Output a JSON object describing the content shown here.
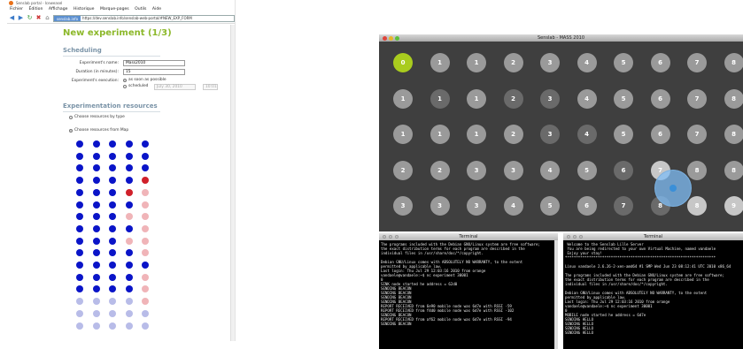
{
  "firefox": {
    "title": "Senslab portal - Iceweasel",
    "menu": [
      "Fichier",
      "Édition",
      "Affichage",
      "Historique",
      "Marque-pages",
      "Outils",
      "Aide"
    ],
    "site_badge": "senslab.info",
    "url": "https://dev.senslab.info/senslab-web-portal/#NEW_EXP_FORM"
  },
  "form": {
    "heading": "New experiment (1/3)",
    "scheduling_heading": "Scheduling",
    "name_label": "Experiment's name:",
    "name_value": "Mass2010",
    "duration_label": "Duration (in minutes):",
    "duration_value": "15",
    "execution_label": "Experiment's execution:",
    "asap_label": "as soon as possible",
    "scheduled_label": "scheduled",
    "scheduled_date": "July 30, 2010",
    "scheduled_time": "10:01",
    "resources_heading": "Experimentation resources",
    "by_type_label": "Choose resources by type",
    "from_map_label": "Choose resources from Map"
  },
  "node_map": {
    "rows": [
      [
        "b",
        "b",
        "b",
        "b",
        "b"
      ],
      [
        "b",
        "b",
        "b",
        "b",
        "b"
      ],
      [
        "b",
        "b",
        "b",
        "b",
        "b"
      ],
      [
        "b",
        "b",
        "b",
        "b",
        "r"
      ],
      [
        "b",
        "b",
        "b",
        "r",
        "pk"
      ],
      [
        "b",
        "b",
        "b",
        "b",
        "pk"
      ],
      [
        "b",
        "b",
        "b",
        "pk",
        "pk"
      ],
      [
        "b",
        "b",
        "b",
        "b",
        "pk"
      ],
      [
        "b",
        "b",
        "b",
        "pk",
        "pk"
      ],
      [
        "b",
        "b",
        "b",
        "b",
        "pk"
      ],
      [
        "b",
        "b",
        "b",
        "b",
        "b"
      ],
      [
        "b",
        "b",
        "b",
        "b",
        "pk"
      ],
      [
        "b",
        "b",
        "b",
        "b",
        "pk"
      ],
      [
        "l",
        "l",
        "l",
        "l",
        "pk"
      ],
      [
        "l",
        "l",
        "l",
        "l",
        "l"
      ],
      [
        "l",
        "l",
        "l",
        "l",
        "l"
      ]
    ],
    "colors": {
      "b": "#0a14c8",
      "r": "#d0202a",
      "pk": "#f0b4b8",
      "l": "#b8bce8"
    }
  },
  "senslab": {
    "title": "Senslab - MASS 2010",
    "grid": [
      [
        0,
        1,
        1,
        2,
        3,
        4,
        5,
        6,
        7,
        8
      ],
      [
        1,
        1,
        1,
        2,
        3,
        4,
        5,
        6,
        7,
        8
      ],
      [
        1,
        1,
        1,
        2,
        3,
        4,
        5,
        6,
        7,
        8
      ],
      [
        2,
        2,
        3,
        3,
        4,
        5,
        6,
        7,
        8,
        8
      ],
      [
        3,
        3,
        3,
        4,
        5,
        6,
        7,
        8,
        8,
        9
      ]
    ],
    "styles": [
      [
        "n3",
        "n0",
        "n0",
        "n0",
        "n0",
        "n0",
        "n0",
        "n0",
        "n0",
        "n0"
      ],
      [
        "n0",
        "n1",
        "n0",
        "n1",
        "n1",
        "n0",
        "n0",
        "n0",
        "n0",
        "n0"
      ],
      [
        "n0",
        "n0",
        "n0",
        "n0",
        "n1",
        "n1",
        "n0",
        "n0",
        "n0",
        "n0"
      ],
      [
        "n0",
        "n0",
        "n0",
        "n0",
        "n0",
        "n0",
        "n1",
        "n2",
        "n0",
        "n0"
      ],
      [
        "n0",
        "n0",
        "n0",
        "n0",
        "n0",
        "n0",
        "n1",
        "n1",
        "n2",
        "n2"
      ]
    ],
    "traffic_colors": [
      "#e0443a",
      "#e8b42a",
      "#5cbf3a"
    ]
  },
  "terminal_left": {
    "title": "Terminal",
    "lines": [
      "The programs included with the Debian GNU/Linux system are free software;",
      "the exact distribution terms for each program are described in the",
      "individual files in /usr/share/doc/*/copyright.",
      "",
      "Debian GNU/Linux comes with ABSOLUTELY NO WARRANTY, to the extent",
      "permitted by applicable law.",
      "Last login: Thu Jul 29 12:03:16 2010 from orange",
      "vandaele@vandaele:~$ nc experiment 30001",
      "0",
      "SINK node started he address = 62d0",
      "SENDING BEACON",
      "SENDING BEACON",
      "SENDING BEACON",
      "SENDING BEACON",
      "REPORT RECEIVED from 6e90 mobile node was 6d7e with RSSI -59",
      "REPORT RECEIVED from f4d0 mobile node was 6d7e with RSSI -102",
      "SENDING BEACON",
      "REPORT RECEIVED from af62 mobile node was 6d7e with RSSI -94",
      "SENDING BEACON"
    ]
  },
  "terminal_right": {
    "title": "Terminal",
    "lines": [
      " Welcome to the Senslab Lille Server",
      " You are being redirected to your own Virtual Machine, named vandaele",
      " Enjoy your stay!",
      "*********************************************************************",
      "",
      "Linux vandaele 2.6.26-2-xen-amd64 #1 SMP Wed Jun 23 08:12:41 UTC 2010 x86_64",
      "",
      "The programs included with the Debian GNU/Linux system are free software;",
      "the exact distribution terms for each program are described in the",
      "individual files in /usr/share/doc/*/copyright.",
      "",
      "Debian GNU/Linux comes with ABSOLUTELY NO WARRANTY, to the extent",
      "permitted by applicable law.",
      "Last login: Thu Jul 29 12:03:16 2010 from orange",
      "vandaele@vandaele:~$ nc experiment 30001",
      "0",
      "MOBILE node started he address = 6d7e",
      "SENDING HELLO",
      "SENDING HELLO",
      "SENDING HELLO",
      "SENDING HELLO"
    ]
  }
}
